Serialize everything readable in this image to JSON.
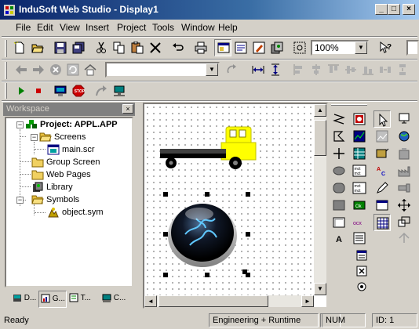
{
  "window": {
    "title": "InduSoft Web Studio - Display1",
    "minimize": "_",
    "maximize": "□",
    "close": "×"
  },
  "menu": [
    {
      "label": "File"
    },
    {
      "label": "Edit"
    },
    {
      "label": "View"
    },
    {
      "label": "Insert"
    },
    {
      "label": "Project"
    },
    {
      "label": "Tools"
    },
    {
      "label": "Window"
    },
    {
      "label": "Help"
    }
  ],
  "toolbar": {
    "zoom": "100%",
    "object_combo": ""
  },
  "workspace": {
    "title": "Workspace",
    "close": "×",
    "tree": {
      "root": "Project: APPL.APP",
      "screens": "Screens",
      "main_scr": "main.scr",
      "group_screen": "Group Screen",
      "web_pages": "Web Pages",
      "library": "Library",
      "symbols": "Symbols",
      "object_sym": "object.sym"
    },
    "tabs": [
      {
        "label": "D..."
      },
      {
        "label": "G..."
      },
      {
        "label": "T..."
      },
      {
        "label": "C..."
      }
    ]
  },
  "status": {
    "ready": "Ready",
    "mode": "Engineering + Runtime",
    "num": "NUM",
    "id": "ID: 1"
  },
  "colors": {
    "truck": "#ffff00",
    "title_start": "#0a246a",
    "title_end": "#a6caf0",
    "stop_red": "#cc0000"
  }
}
